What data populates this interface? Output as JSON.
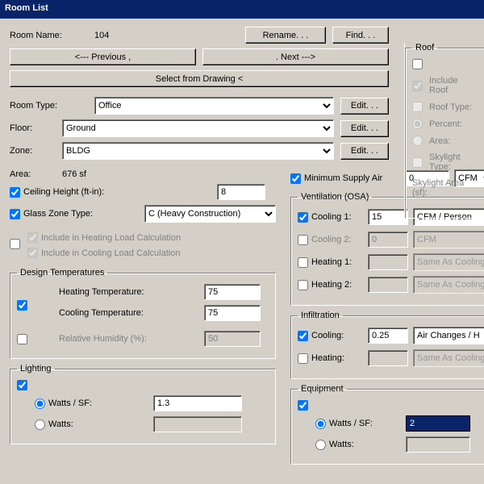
{
  "window_title": "Room List",
  "labels": {
    "room_name": "Room Name:",
    "room_type": "Room Type:",
    "floor": "Floor:",
    "zone": "Zone:",
    "area": "Area:",
    "ceiling": "Ceiling Height (ft-in):",
    "glass_zone": "Glass Zone Type:",
    "include_heat": "Include in Heating Load Calculation",
    "include_cool": "Include in Cooling Load Calculation",
    "design_temp_legend": "Design Temperatures",
    "heating_temp": "Heating Temperature:",
    "cooling_temp": "Cooling Temperature:",
    "rel_hum": "Relative Humidity (%):",
    "lighting_legend": "Lighting",
    "equipment_legend": "Equipment",
    "watts_sf": "Watts / SF:",
    "watts": "Watts:",
    "min_supply": "Minimum Supply Air",
    "ventilation_legend": "Ventilation (OSA)",
    "cooling1": "Cooling 1:",
    "cooling2": "Cooling 2:",
    "heating1": "Heating 1:",
    "heating2": "Heating 2:",
    "infiltration_legend": "Infiltration",
    "cooling": "Cooling:",
    "heating": "Heating:",
    "roof_legend": "Roof",
    "include_roof": "Include Roof",
    "roof_type": "Roof Type:",
    "percent": "Percent:",
    "area_opt": "Area:",
    "skylight_type": "Skylight Type:",
    "skylight_area": "Skylight Area (sf):"
  },
  "buttons": {
    "rename": "Rename. . .",
    "find": "Find. . .",
    "prev": "<--- Previous ,",
    "next": ". Next --->",
    "select_drawing": "Select from Drawing <",
    "edit": "Edit. . ."
  },
  "values": {
    "room_name": "104",
    "room_type": "Office",
    "floor": "Ground",
    "zone": "BLDG",
    "area": "676 sf",
    "ceiling": "8",
    "glass_zone": "C (Heavy Construction)",
    "heat_temp": "75",
    "cool_temp": "75",
    "rel_hum": "50",
    "lighting_wsf": "1.3",
    "lighting_watts": "",
    "equipment_wsf": "2",
    "equipment_watts": "",
    "min_supply": "0",
    "min_supply_unit": "CFM",
    "cooling1": "15",
    "cooling1_unit": "CFM / Person",
    "cooling2": "0",
    "cooling2_unit": "CFM",
    "heating1": "",
    "heating1_unit": "Same As Cooling",
    "heating2": "",
    "heating2_unit": "Same As Cooling",
    "inf_cooling": "0.25",
    "inf_cooling_unit": "Air Changes / H",
    "inf_heating": "",
    "inf_heating_unit": "Same As Cooling"
  },
  "checkboxes": {
    "ceiling": true,
    "glass_zone": true,
    "include_master": false,
    "include_heat": true,
    "include_cool": true,
    "design_heat_row": true,
    "design_relhum_row": false,
    "min_supply": true,
    "vent_cooling1": true,
    "vent_cooling2": false,
    "vent_heating1": false,
    "vent_heating2": false,
    "inf_cooling": true,
    "inf_heating": false,
    "lighting_enable": true,
    "equipment_enable": true,
    "roof_enable": false,
    "include_roof": true,
    "roof_type": false
  },
  "radios": {
    "lighting": "wsf",
    "equipment": "wsf",
    "roof_pct_area": "percent"
  }
}
